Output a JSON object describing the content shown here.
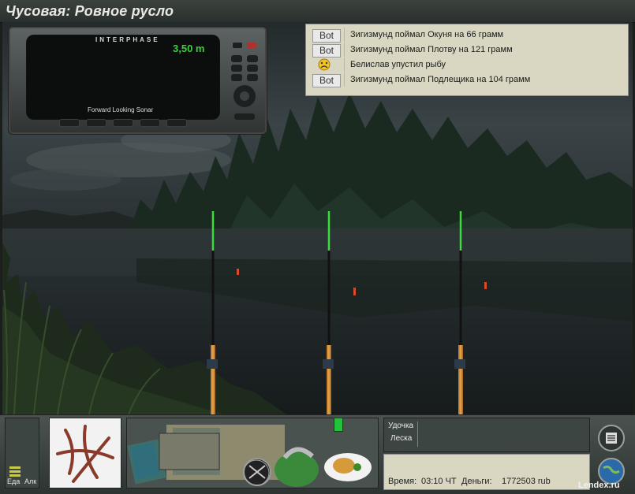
{
  "window": {
    "title": "Чусовая: Ровное русло"
  },
  "sonar": {
    "brand": "INTERPHASE",
    "depth": "3,50 m",
    "caption": "Forward Looking Sonar"
  },
  "chat": {
    "messages": [
      {
        "sender": "Bot",
        "icon": "bot-badge",
        "text": "Зигизмунд поймал Окуня на 66 грамм"
      },
      {
        "sender": "Bot",
        "icon": "bot-badge",
        "text": "Зигизмунд поймал Плотву на 121 грамм"
      },
      {
        "sender": "",
        "icon": "sad-smiley-icon",
        "text": "Белислав упустил рыбу"
      },
      {
        "sender": "Bot",
        "icon": "bot-badge",
        "text": "Зигизмунд поймал Подлещика на 104 грамм"
      }
    ]
  },
  "status": {
    "food_label": "Еда",
    "alcohol_label": "Алк"
  },
  "tackle": {
    "rod_label": "Удочка",
    "line_label": "Леска"
  },
  "info": {
    "time_label": "Время:",
    "time_value": "03:10 ЧТ",
    "money_label": "Деньги:",
    "money_value": "1772503 rub"
  },
  "watermark": "Lendex.ru",
  "colors": {
    "chat_bg": "#d9d7c2",
    "panel_bg": "#3d4542",
    "rod_tip_green": "#3cdc3c",
    "sonar_depth_green": "#3ccf3f",
    "bite_indicator": "#22c33a"
  }
}
